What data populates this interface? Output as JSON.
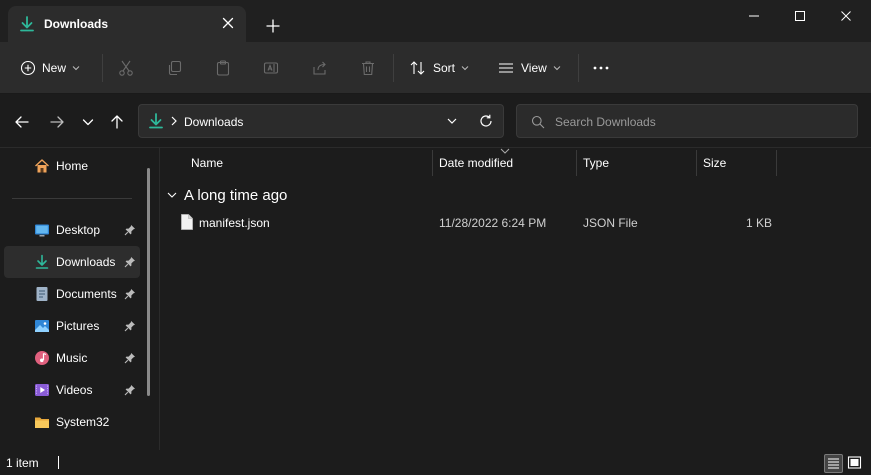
{
  "window": {
    "tab_title": "Downloads",
    "tab_icon": "download-icon",
    "accent": "#2eb89a"
  },
  "commandbar": {
    "new_label": "New",
    "sort_label": "Sort",
    "view_label": "View"
  },
  "address": {
    "path": "Downloads",
    "search_placeholder": "Search Downloads"
  },
  "sidebar": {
    "home": "Home",
    "items": [
      {
        "label": "Desktop",
        "icon": "desktop-icon",
        "pinned": true
      },
      {
        "label": "Downloads",
        "icon": "download-icon",
        "pinned": true,
        "selected": true
      },
      {
        "label": "Documents",
        "icon": "documents-icon",
        "pinned": true
      },
      {
        "label": "Pictures",
        "icon": "pictures-icon",
        "pinned": true
      },
      {
        "label": "Music",
        "icon": "music-icon",
        "pinned": true
      },
      {
        "label": "Videos",
        "icon": "videos-icon",
        "pinned": true
      },
      {
        "label": "System32",
        "icon": "folder-icon",
        "pinned": false
      }
    ]
  },
  "filelist": {
    "columns": [
      "Name",
      "Date modified",
      "Type",
      "Size"
    ],
    "group": "A long time ago",
    "rows": [
      {
        "name": "manifest.json",
        "date": "11/28/2022 6:24 PM",
        "type": "JSON File",
        "size": "1 KB",
        "icon": "file-icon"
      }
    ]
  },
  "statusbar": {
    "count": "1 item"
  }
}
